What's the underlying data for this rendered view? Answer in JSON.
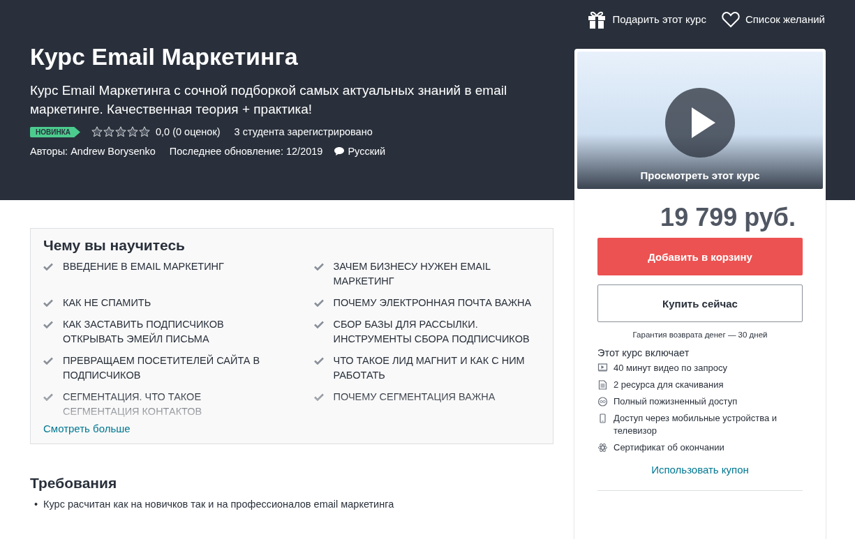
{
  "top_links": [
    {
      "kind": "gift",
      "label": "Подарить этот курс"
    },
    {
      "kind": "wishlist",
      "label": "Список желаний"
    }
  ],
  "course": {
    "title": "Курс Email Маркетинга",
    "subtitle": "Курс Email Маркетинга с сочной подборкой самых актуальных знаний в email маркетинге. Качественная теория + практика!",
    "badge": "НОВИНКА",
    "stars": 0,
    "rating": "0,0 (0 оценок)",
    "students": "3 студента зарегистрировано",
    "authors": "Авторы: Andrew Borysenko",
    "updated": "Последнее обновление: 12/2019",
    "language": "Русский"
  },
  "learn": {
    "title": "Чему вы научитесь",
    "items": [
      "ВВЕДЕНИЕ В EMAIL МАРКЕТИНГ",
      "ЗАЧЕМ БИЗНЕСУ НУЖЕН EMAIL МАРКЕТИНГ",
      "КАК НЕ СПАМИТЬ",
      "ПОЧЕМУ ЭЛЕКТРОННАЯ ПОЧТА ВАЖНА",
      "КАК ЗАСТАВИТЬ ПОДПИСЧИКОВ ОТКРЫВАТЬ ЭМЕЙЛ ПИСЬМА",
      "СБОР БАЗЫ ДЛЯ РАССЫЛКИ. ИНСТРУМЕНТЫ СБОРА ПОДПИСЧИКОВ",
      "ПРЕВРАЩАЕМ ПОСЕТИТЕЛЕЙ САЙТА В ПОДПИСЧИКОВ",
      "ЧТО ТАКОЕ ЛИД МАГНИТ И КАК С НИМ РАБОТАТЬ",
      "СЕГМЕНТАЦИЯ. ЧТО ТАКОЕ СЕГМЕНТАЦИЯ КОНТАКТОВ",
      "ПОЧЕМУ СЕГМЕНТАЦИЯ ВАЖНА"
    ],
    "more_link": "Смотреть больше"
  },
  "requirements": {
    "title": "Требования",
    "bullet": "•",
    "items": [
      "Курс расчитан как на новичков так и на профессионалов email маркетинга"
    ]
  },
  "purchase": {
    "preview_label": "Просмотреть этот курс",
    "price": "19 799 руб.",
    "add_to_cart": "Добавить в корзину",
    "buy_now": "Купить сейчас",
    "guarantee": "Гарантия возврата денег — 30 дней",
    "includes_title": "Этот курс включает",
    "includes": [
      {
        "kind": "video",
        "text": "40 минут видео по запросу"
      },
      {
        "kind": "file",
        "text": "2 ресурса для скачивания"
      },
      {
        "kind": "lifetime",
        "text": "Полный пожизненный доступ"
      },
      {
        "kind": "mobile",
        "text": "Доступ через мобильные устройства и телевизор"
      },
      {
        "kind": "certificate",
        "text": "Сертификат об окончании"
      }
    ],
    "coupon": "Использовать купон"
  }
}
